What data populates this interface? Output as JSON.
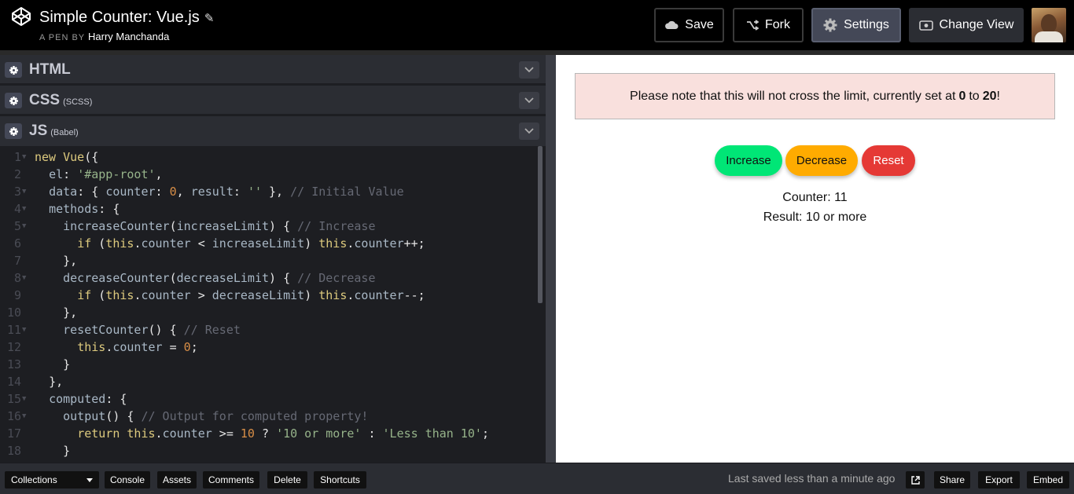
{
  "header": {
    "title": "Simple Counter: Vue.js",
    "byline_prefix": "A PEN BY",
    "author": "Harry Manchanda",
    "buttons": {
      "save": "Save",
      "fork": "Fork",
      "settings": "Settings",
      "change_view": "Change View"
    }
  },
  "panels": [
    {
      "label": "HTML",
      "sub": ""
    },
    {
      "label": "CSS",
      "sub": "(SCSS)"
    },
    {
      "label": "JS",
      "sub": "(Babel)"
    }
  ],
  "code": {
    "line_numbers": [
      "1",
      "2",
      "3",
      "4",
      "5",
      "6",
      "7",
      "8",
      "9",
      "10",
      "11",
      "12",
      "13",
      "14",
      "15",
      "16",
      "17",
      "18"
    ],
    "foldable_lines": [
      1,
      3,
      4,
      5,
      8,
      11,
      15,
      16
    ]
  },
  "preview": {
    "notice_prefix": "Please note that this will not cross the limit, currently set at",
    "notice_min": "0",
    "notice_to": "to",
    "notice_max": "20",
    "notice_suffix": "!",
    "buttons": {
      "increase": "Increase",
      "decrease": "Decrease",
      "reset": "Reset"
    },
    "counter_text": "Counter: 11",
    "result_text": "Result: 10 or more"
  },
  "footer": {
    "collections": "Collections",
    "console": "Console",
    "assets": "Assets",
    "comments": "Comments",
    "delete": "Delete",
    "shortcuts": "Shortcuts",
    "saved_status": "Last saved less than a minute ago",
    "share": "Share",
    "export": "Export",
    "embed": "Embed"
  },
  "colors": {
    "increase": "#00e676",
    "decrease": "#ffab00",
    "reset": "#e53935",
    "notice_bg": "#f9e0dd",
    "editor_bg": "#1d1e22"
  },
  "icons": [
    "codepen-logo-icon",
    "pencil-icon",
    "cloud-icon",
    "fork-icon",
    "gear-icon",
    "eye-icon",
    "chevron-down-icon",
    "external-link-icon",
    "caret-down-icon"
  ]
}
